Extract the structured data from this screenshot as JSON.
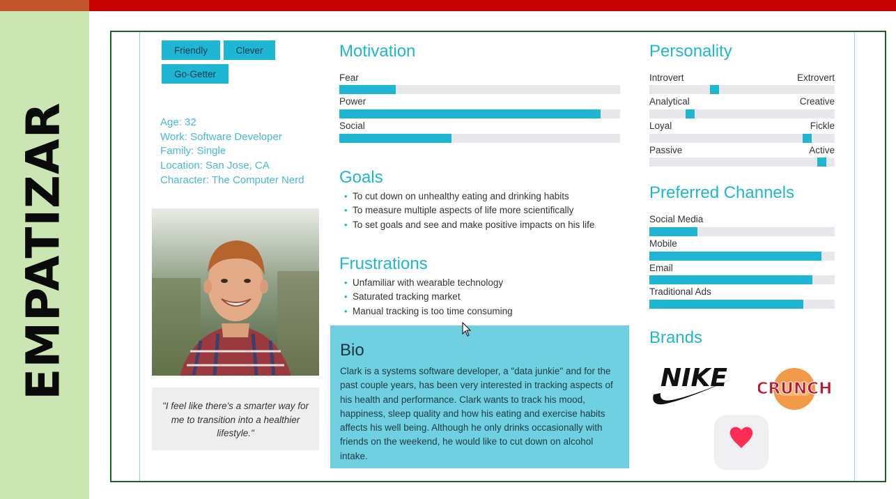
{
  "side_title": "EMPATIZAR",
  "tags": [
    "Friendly",
    "Clever",
    "Go-Getter"
  ],
  "info": [
    "Age: 32",
    "Work: Software Developer",
    "Family: Single",
    "Location: San Jose, CA",
    "Character: The Computer Nerd"
  ],
  "quote": "\"I feel like there's a smarter way for me to transition into a healthier lifestyle.\"",
  "motivation": {
    "title": "Motivation",
    "items": [
      {
        "label": "Fear",
        "level": 0.2
      },
      {
        "label": "Power",
        "level": 0.93
      },
      {
        "label": "Social",
        "level": 0.4
      }
    ]
  },
  "goals": {
    "title": "Goals",
    "items": [
      "To cut down on unhealthy eating and drinking habits",
      "To measure multiple aspects of life more scientifically",
      "To set goals and see and make positive impacts on his life"
    ]
  },
  "frustrations": {
    "title": "Frustrations",
    "items": [
      "Unfamiliar with wearable technology",
      "Saturated tracking market",
      "Manual tracking is too time consuming"
    ]
  },
  "bio": {
    "title": "Bio",
    "text": "Clark is a systems software developer, a \"data junkie\" and for the past couple years, has been very interested in tracking aspects of his health and performance. Clark wants to track his mood, happiness, sleep quality and how his eating and exercise habits affects his well being. Although he only drinks occasionally with friends on the weekend, he would like to cut down on alcohol intake."
  },
  "personality": {
    "title": "Personality",
    "items": [
      {
        "left": "Introvert",
        "right": "Extrovert",
        "level": 0.35
      },
      {
        "left": "Analytical",
        "right": "Creative",
        "level": 0.22
      },
      {
        "left": "Loyal",
        "right": "Fickle",
        "level": 0.85
      },
      {
        "left": "Passive",
        "right": "Active",
        "level": 0.93
      }
    ]
  },
  "channels": {
    "title": "Preferred Channels",
    "items": [
      {
        "label": "Social Media",
        "level": 0.26
      },
      {
        "label": "Mobile",
        "level": 0.93
      },
      {
        "label": "Email",
        "level": 0.88
      },
      {
        "label": "Traditional Ads",
        "level": 0.83
      }
    ]
  },
  "brands": {
    "title": "Brands",
    "logos": [
      "NIKE",
      "CRUNCH"
    ],
    "icons": [
      "health-heart-icon"
    ]
  },
  "colors": {
    "accent": "#1fb6d4",
    "bio_bg": "#6fd0e2",
    "sidebar_bg": "#cbe6b2",
    "top_bar": "#c60000"
  }
}
